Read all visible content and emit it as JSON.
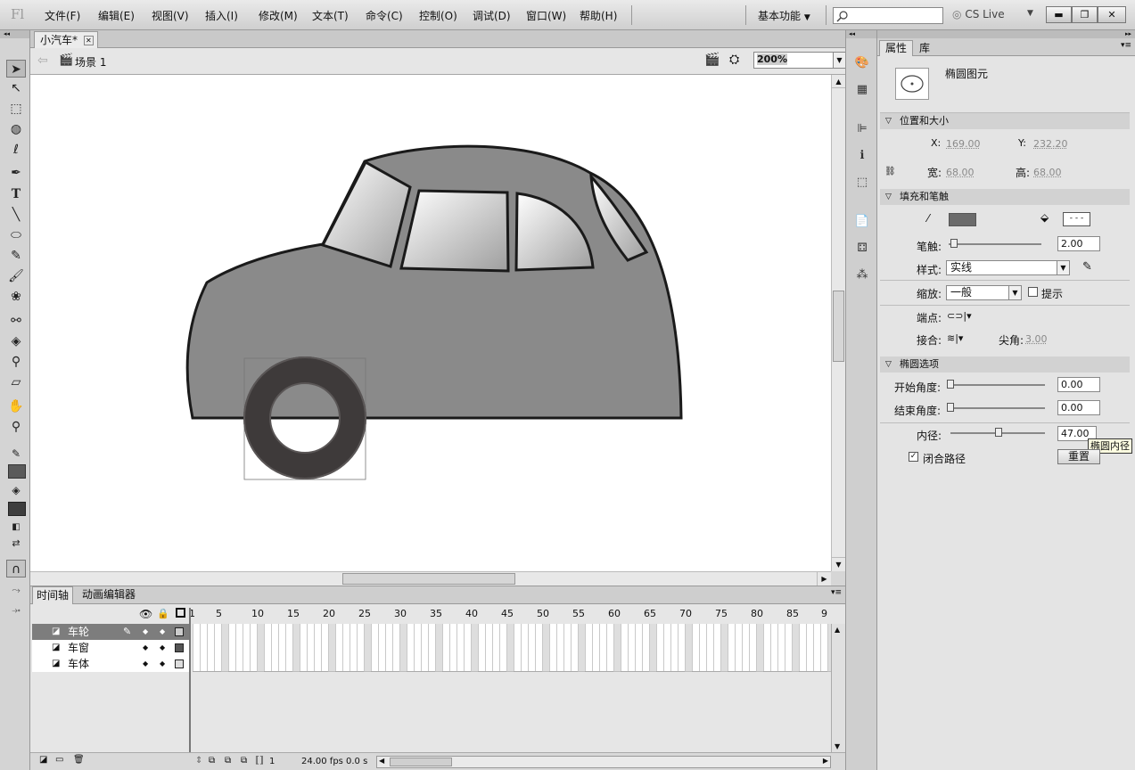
{
  "app": {
    "logo": "Fl"
  },
  "menu": [
    "文件(F)",
    "编辑(E)",
    "视图(V)",
    "插入(I)",
    "修改(M)",
    "文本(T)",
    "命令(C)",
    "控制(O)",
    "调试(D)",
    "窗口(W)",
    "帮助(H)"
  ],
  "workspace": {
    "label": "基本功能",
    "cslive": "CS Live"
  },
  "window_buttons": {
    "min": "▬",
    "max": "❐",
    "close": "✕"
  },
  "document": {
    "tab_title": "小汽车*",
    "scene": "场景 1",
    "zoom": "200%"
  },
  "timeline": {
    "tabs": [
      "时间轴",
      "动画编辑器"
    ],
    "frame_numbers": [
      "1",
      "5",
      "10",
      "15",
      "20",
      "25",
      "30",
      "35",
      "40",
      "45",
      "50",
      "55",
      "60",
      "65",
      "70",
      "75",
      "80",
      "85",
      "9"
    ],
    "layers": [
      {
        "name": "车轮",
        "selected": true
      },
      {
        "name": "车窗",
        "selected": false
      },
      {
        "name": "车体",
        "selected": false
      }
    ],
    "status": {
      "frame": "1",
      "fps": "24.00 fps",
      "time": "0.0 s"
    }
  },
  "properties": {
    "tabs": [
      "属性",
      "库"
    ],
    "object_type": "椭圆图元",
    "position_size": {
      "header": "位置和大小",
      "x_label": "X:",
      "x": "169.00",
      "y_label": "Y:",
      "y": "232.20",
      "w_label": "宽:",
      "w": "68.00",
      "h_label": "高:",
      "h": "68.00"
    },
    "fill_stroke": {
      "header": "填充和笔触",
      "stroke_label": "笔触:",
      "stroke_value": "2.00",
      "stroke_level": 0.02,
      "style_label": "样式:",
      "style_value": "实线",
      "scale_label": "缩放:",
      "scale_value": "一般",
      "hint_label": "提示",
      "cap_label": "端点:",
      "join_label": "接合:",
      "miter_label": "尖角:",
      "miter_value": "3.00",
      "fill_color": "#6b6b6b"
    },
    "oval_options": {
      "header": "椭圆选项",
      "start_angle_label": "开始角度:",
      "start_angle": "0.00",
      "end_angle_label": "结束角度:",
      "end_angle": "0.00",
      "inner_radius_label": "内径:",
      "inner_radius": "47.00",
      "inner_radius_level": 0.47,
      "tooltip": "椭圆内径",
      "close_path_label": "闭合路径",
      "reset_label": "重置"
    }
  },
  "canvas": {
    "car_body_color": "#8a8a8a",
    "window_gradient": [
      "#ffffff",
      "#9e9e9e"
    ],
    "wheel_color": "#3e3a3a",
    "wheel_ring_color": "#5a5656"
  }
}
